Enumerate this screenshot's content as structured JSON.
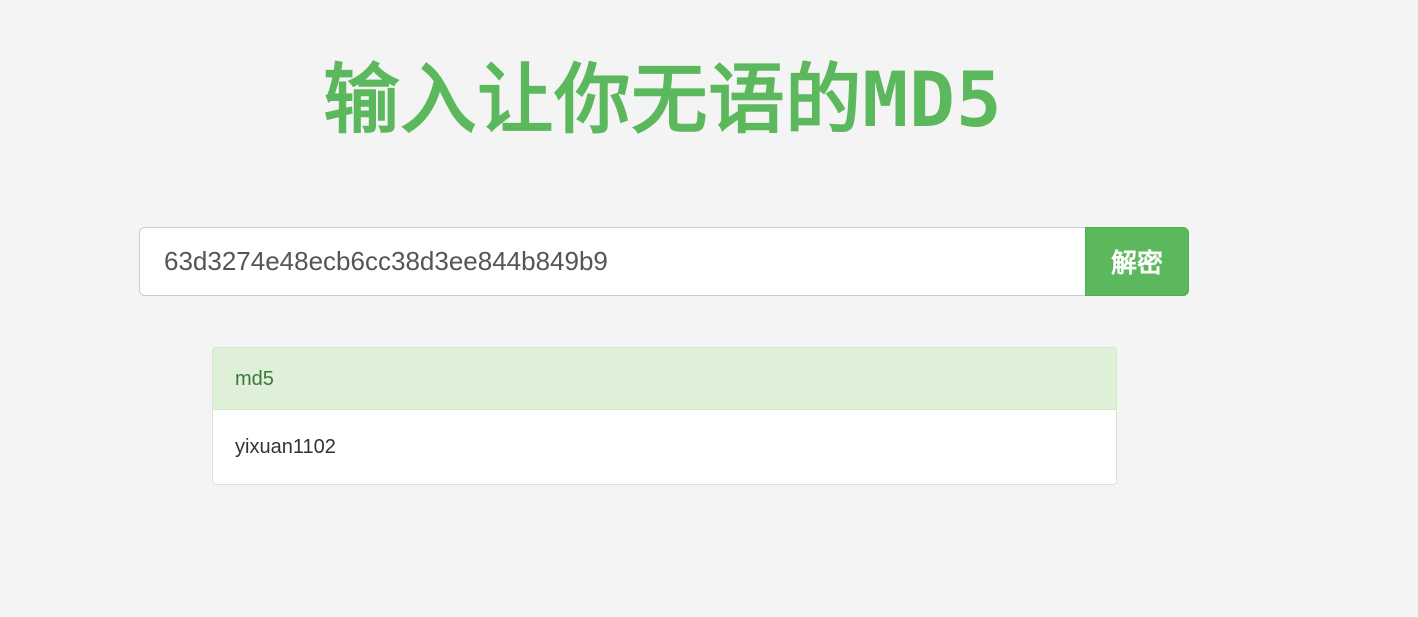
{
  "page": {
    "title": "输入让你无语的MD5"
  },
  "search": {
    "value": "63d3274e48ecb6cc38d3ee844b849b9",
    "button_label": "解密"
  },
  "result": {
    "header": "md5",
    "value": "yixuan1102"
  },
  "colors": {
    "accent": "#5cb85c",
    "panel_header_bg": "#dff0d8",
    "panel_header_text": "#3c763d",
    "page_bg": "#f4f4f4"
  }
}
